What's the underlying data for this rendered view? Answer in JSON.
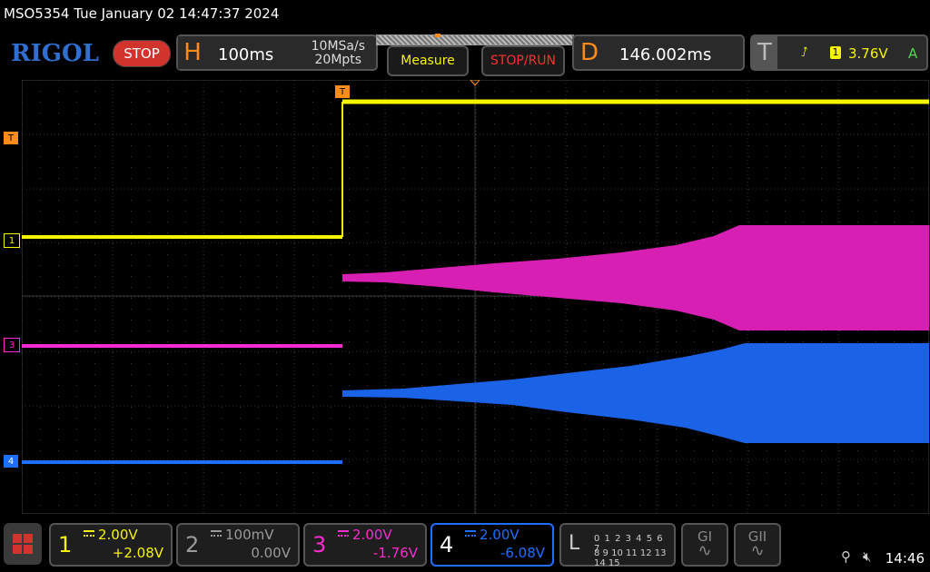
{
  "header": {
    "model_datetime": "MSO5354  Tue January 02 14:47:37 2024"
  },
  "toolbar": {
    "logo": "RIGOL",
    "run_state": "STOP",
    "horizontal": {
      "letter": "H",
      "timebase": "100ms",
      "sample_rate": "10MSa/s",
      "memory_depth": "20Mpts"
    },
    "measure_label": "Measure",
    "stop_run_label": "STOP/RUN",
    "delay": {
      "letter": "D",
      "value": "146.002ms"
    },
    "trigger": {
      "letter": "T",
      "source": "1",
      "level": "3.76V",
      "mode": "A"
    }
  },
  "screen_markers": {
    "trigger_level": "T",
    "trigger_position": "T",
    "ch1": "1",
    "ch3": "3",
    "ch4": "4"
  },
  "channels": [
    {
      "num": "1",
      "scale": "2.00V",
      "offset": "+2.08V",
      "color": "#f5f500",
      "active": false
    },
    {
      "num": "2",
      "scale": "100mV",
      "offset": "0.00V",
      "color": "#9a9a9a",
      "active": false
    },
    {
      "num": "3",
      "scale": "2.00V",
      "offset": "-1.76V",
      "color": "#ff2bd2",
      "active": false
    },
    {
      "num": "4",
      "scale": "2.00V",
      "offset": "-6.08V",
      "color": "#1e6fff",
      "active": true
    }
  ],
  "logic": {
    "label": "L",
    "row1": "0 1 2 3   4 5 6 7",
    "row2": "8 9 10 11 12 13 14 15"
  },
  "gen_buttons": [
    {
      "label": "GI"
    },
    {
      "label": "GII"
    }
  ],
  "status": {
    "time": "14:46"
  },
  "colors": {
    "ch1": "#f5f500",
    "ch3": "#ff2bd2",
    "ch4": "#1e6fff",
    "trigger": "#ff8c1a",
    "accent": "#2f6fd1"
  }
}
